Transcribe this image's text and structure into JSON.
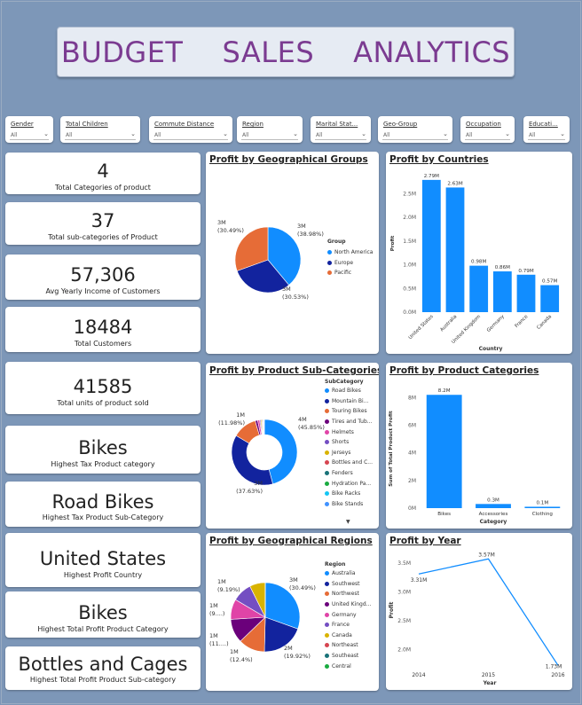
{
  "header": {
    "words": [
      "BUDGET",
      "SALES",
      "ANALYTICS"
    ]
  },
  "slicers": [
    {
      "label": "Gender",
      "value": "All"
    },
    {
      "label": "Total Children",
      "value": "All"
    },
    {
      "label": "Commute Distance",
      "value": "All"
    },
    {
      "label": "Region",
      "value": "All"
    },
    {
      "label": "Marital Stat...",
      "value": "All"
    },
    {
      "label": "Geo-Group",
      "value": "All"
    },
    {
      "label": "Occupation",
      "value": "All"
    },
    {
      "label": "Educati...",
      "value": "All"
    }
  ],
  "kpis": [
    {
      "value": "4",
      "label": "Total Categories of product"
    },
    {
      "value": "37",
      "label": "Total sub-categories of Product"
    },
    {
      "value": "57,306",
      "label": "Avg Yearly Income of Customers"
    },
    {
      "value": "18484",
      "label": "Total Customers"
    },
    {
      "value": "41585",
      "label": "Total units of product sold"
    },
    {
      "value": "Bikes",
      "label": "Highest Tax Product category"
    },
    {
      "value": "Road Bikes",
      "label": "Highest Tax Product Sub-Category"
    },
    {
      "value": "United States",
      "label": "Highest Profit Country"
    },
    {
      "value": "Bikes",
      "label": "Highest Total Profit Product Category"
    },
    {
      "value": "Bottles and Cages",
      "label": "Highest Total Profit Product Sub-category"
    }
  ],
  "chart_data": [
    {
      "type": "pie",
      "title": "Profit by Geographical Groups",
      "legend_title": "Group",
      "categories": [
        "North America",
        "Europe",
        "Pacific"
      ],
      "values": [
        38.98,
        30.53,
        30.49
      ],
      "value_labels": [
        "3M",
        "3M",
        "3M"
      ],
      "percent_labels": [
        "(38.98%)",
        "(30.53%)",
        "(30.49%)"
      ],
      "colors": [
        "#118dff",
        "#12239e",
        "#e66c37"
      ]
    },
    {
      "type": "bar",
      "title": "Profit by Countries",
      "xlabel": "Country",
      "ylabel": "Profit",
      "categories": [
        "United States",
        "Australia",
        "United Kingdom",
        "Germany",
        "France",
        "Canada"
      ],
      "values": [
        2.79,
        2.63,
        0.98,
        0.86,
        0.79,
        0.57
      ],
      "data_labels": [
        "2.79M",
        "2.63M",
        "0.98M",
        "0.86M",
        "0.79M",
        "0.57M"
      ],
      "ticks": [
        "0.0M",
        "0.5M",
        "1.0M",
        "1.5M",
        "2.0M",
        "2.5M"
      ],
      "ylim": [
        0,
        2.9
      ],
      "color": "#118dff"
    },
    {
      "type": "pie",
      "title": "Profit by Product Sub-Categories",
      "legend_title": "SubCategory",
      "categories": [
        "Road Bikes",
        "Mountain Bi...",
        "Touring Bikes",
        "Tires and Tub...",
        "Helmets",
        "Shorts",
        "Jerseys",
        "Bottles and C...",
        "Fenders",
        "Hydration Pa...",
        "Bike Racks",
        "Bike Stands"
      ],
      "values": [
        45.85,
        37.63,
        11.98,
        1.2,
        1.0,
        0.5,
        0.5,
        0.4,
        0.3,
        0.3,
        0.2,
        0.14
      ],
      "value_labels": [
        "4M",
        "3M",
        "1M"
      ],
      "percent_labels": [
        "(45.85%)",
        "(37.63%)",
        "(11.98%)"
      ],
      "colors": [
        "#118dff",
        "#12239e",
        "#e66c37",
        "#6b007b",
        "#e044a7",
        "#744ec2",
        "#d9b300",
        "#d64550",
        "#197278",
        "#1aab40",
        "#15c6f4",
        "#4092ff"
      ]
    },
    {
      "type": "bar",
      "title": "Profit by Product Categories",
      "xlabel": "Category",
      "ylabel": "Sum of Total Product Profit",
      "categories": [
        "Bikes",
        "Accessories",
        "Clothing"
      ],
      "values": [
        8.2,
        0.3,
        0.1
      ],
      "data_labels": [
        "8.2M",
        "0.3M",
        "0.1M"
      ],
      "ticks": [
        "0M",
        "2M",
        "4M",
        "6M",
        "8M"
      ],
      "ylim": [
        0,
        8.6
      ],
      "color": "#118dff"
    },
    {
      "type": "pie",
      "title": "Profit by Geographical Regions",
      "legend_title": "Region",
      "categories": [
        "Australia",
        "Southwest",
        "Northwest",
        "United Kingd...",
        "Germany",
        "France",
        "Canada",
        "Northeast",
        "Southeast",
        "Central"
      ],
      "values": [
        30.49,
        19.92,
        12.4,
        11.2,
        9.5,
        9.19,
        7.3,
        0.01,
        0.01,
        0.01
      ],
      "slice_labels": [
        "3M\n(30.49%)",
        "2M\n(19.92%)",
        "1M\n(12.4%)",
        "1M\n(11....)",
        "1M\n(9....)",
        "1M\n(9.19%)"
      ],
      "colors": [
        "#118dff",
        "#12239e",
        "#e66c37",
        "#6b007b",
        "#e044a7",
        "#744ec2",
        "#d9b300",
        "#d64550",
        "#197278",
        "#1aab40"
      ]
    },
    {
      "type": "line",
      "title": "Profit by Year",
      "xlabel": "Year",
      "ylabel": "Profit",
      "x": [
        2014,
        2015,
        2016
      ],
      "values": [
        3.31,
        3.57,
        1.73
      ],
      "data_labels": [
        "3.31M",
        "3.57M",
        "1.73M"
      ],
      "ticks": [
        "2.0M",
        "2.5M",
        "3.0M",
        "3.5M"
      ],
      "ylim": [
        1.75,
        3.62
      ],
      "color": "#118dff"
    }
  ]
}
